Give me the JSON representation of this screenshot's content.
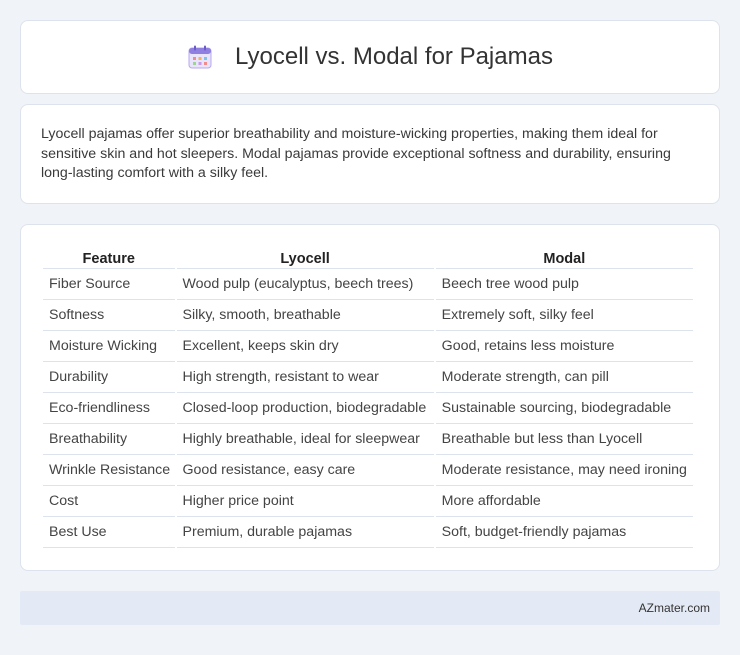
{
  "header": {
    "title": "Lyocell vs. Modal for Pajamas",
    "icon": "calendar-icon"
  },
  "summary": {
    "text": "Lyocell pajamas offer superior breathability and moisture-wicking properties, making them ideal for sensitive skin and hot sleepers. Modal pajamas provide exceptional softness and durability, ensuring long-lasting comfort with a silky feel."
  },
  "table": {
    "headers": [
      "Feature",
      "Lyocell",
      "Modal"
    ],
    "rows": [
      [
        "Fiber Source",
        "Wood pulp (eucalyptus, beech trees)",
        "Beech tree wood pulp"
      ],
      [
        "Softness",
        "Silky, smooth, breathable",
        "Extremely soft, silky feel"
      ],
      [
        "Moisture Wicking",
        "Excellent, keeps skin dry",
        "Good, retains less moisture"
      ],
      [
        "Durability",
        "High strength, resistant to wear",
        "Moderate strength, can pill"
      ],
      [
        "Eco-friendliness",
        "Closed-loop production, biodegradable",
        "Sustainable sourcing, biodegradable"
      ],
      [
        "Breathability",
        "Highly breathable, ideal for sleepwear",
        "Breathable but less than Lyocell"
      ],
      [
        "Wrinkle Resistance",
        "Good resistance, easy care",
        "Moderate resistance, may need ironing"
      ],
      [
        "Cost",
        "Higher price point",
        "More affordable"
      ],
      [
        "Best Use",
        "Premium, durable pajamas",
        "Soft, budget-friendly pajamas"
      ]
    ]
  },
  "footer": {
    "brand": "AZmater.com"
  }
}
